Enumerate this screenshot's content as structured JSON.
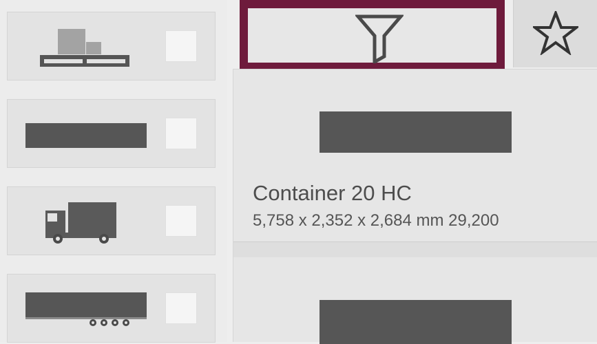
{
  "sidebar": {
    "items": [
      {
        "icon": "pallet-icon",
        "checked": false
      },
      {
        "icon": "container-icon",
        "checked": false
      },
      {
        "icon": "truck-icon",
        "checked": false
      },
      {
        "icon": "trailer-icon",
        "checked": false
      }
    ]
  },
  "toolbar": {
    "filter_icon": "filter-icon",
    "favorites_icon": "star-icon",
    "highlight_color": "#6e1b3c"
  },
  "results": {
    "items": [
      {
        "icon": "container-icon",
        "title": "Container 20 HC",
        "dimensions": "5,758 x 2,352 x 2,684 mm 29,200"
      },
      {
        "icon": "container-icon"
      }
    ]
  }
}
